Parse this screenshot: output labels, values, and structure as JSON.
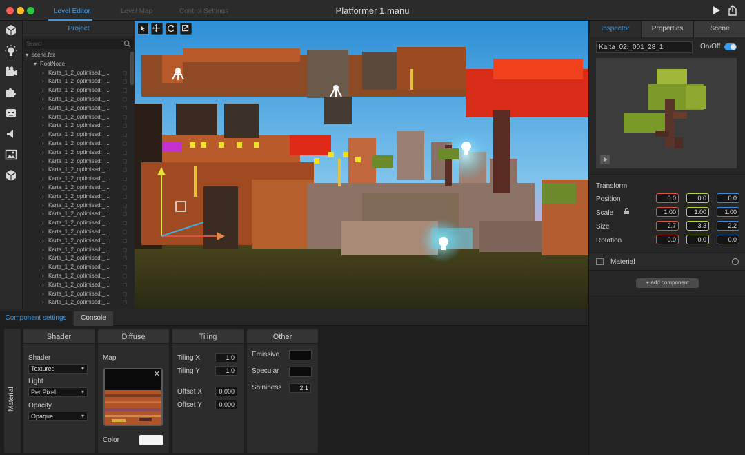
{
  "window": {
    "title": "Platformer 1.manu",
    "tabs": [
      "Level Editor",
      "Level Map",
      "Control Settings"
    ],
    "active_tab": "Level Editor"
  },
  "project": {
    "title": "Project",
    "search_placeholder": "Search",
    "root_file": "scene.fbx",
    "root_node": "RootNode",
    "items": [
      "Karta_1_2_optimised:_...",
      "Karta_1_2_optimised:_...",
      "Karta_1_2_optimised:_...",
      "Karta_1_2_optimised:_...",
      "Karta_1_2_optimised:_...",
      "Karta_1_2_optimised:_...",
      "Karta_1_2_optimised:_...",
      "Karta_1_2_optimised:_...",
      "Karta_1_2_optimised:_...",
      "Karta_1_2_optimised:_...",
      "Karta_1_2_optimised:_...",
      "Karta_1_2_optimised:_...",
      "Karta_1_2_optimised:_...",
      "Karta_1_2_optimised:_...",
      "Karta_1_2_optimised:_...",
      "Karta_1_2_optimised:_...",
      "Karta_1_2_optimised:_...",
      "Karta_1_2_optimised:_...",
      "Karta_1_2_optimised:_...",
      "Karta_1_2_optimised:_...",
      "Karta_1_2_optimised:_...",
      "Karta_1_2_optimised:_...",
      "Karta_1_2_optimised:_...",
      "Karta_1_2_optimised:_...",
      "Karta_1_2_optimised:_...",
      "Karta_1_2_optimised:_...",
      "Karta_1_2_optimised:_..."
    ]
  },
  "inspector": {
    "tabs": [
      "Inspector",
      "Properties",
      "Scene"
    ],
    "object_name": "Karta_02:_001_28_1",
    "onoff_label": "On/Off",
    "transform_title": "Transform",
    "rows": [
      {
        "label": "Position",
        "x": "0.0",
        "y": "0.0",
        "z": "0.0"
      },
      {
        "label": "Scale",
        "x": "1.00",
        "y": "1.00",
        "z": "1.00"
      },
      {
        "label": "Size",
        "x": "2.7",
        "y": "3.3",
        "z": "2.2"
      },
      {
        "label": "Rotation",
        "x": "0.0",
        "y": "0.0",
        "z": "0.0"
      }
    ],
    "material_label": "Material",
    "add_component": "+ add component"
  },
  "bottom": {
    "tabs": [
      "Component settings",
      "Console"
    ],
    "side_label": "Material",
    "shader": {
      "title": "Shader",
      "shader_label": "Shader",
      "shader_value": "Textured",
      "light_label": "Light",
      "light_value": "Per Pixel",
      "opacity_label": "Opacity",
      "opacity_value": "Opaque"
    },
    "diffuse": {
      "title": "Diffuse",
      "map_label": "Map",
      "color_label": "Color"
    },
    "tiling": {
      "title": "Tiling",
      "tx_label": "Tiling X",
      "tx": "1.0",
      "ty_label": "Tiling Y",
      "ty": "1.0",
      "ox_label": "Offset X",
      "ox": "0.000",
      "oy_label": "Offset Y",
      "oy": "0.000"
    },
    "other": {
      "title": "Other",
      "emissive_label": "Emissive",
      "specular_label": "Specular",
      "shininess_label": "Shininess",
      "shininess": "2.1"
    }
  },
  "colors": {
    "accent": "#3d9be9",
    "axis_x": "#d9563c",
    "axis_y": "#b8d23a",
    "axis_z": "#3a8ad9"
  }
}
